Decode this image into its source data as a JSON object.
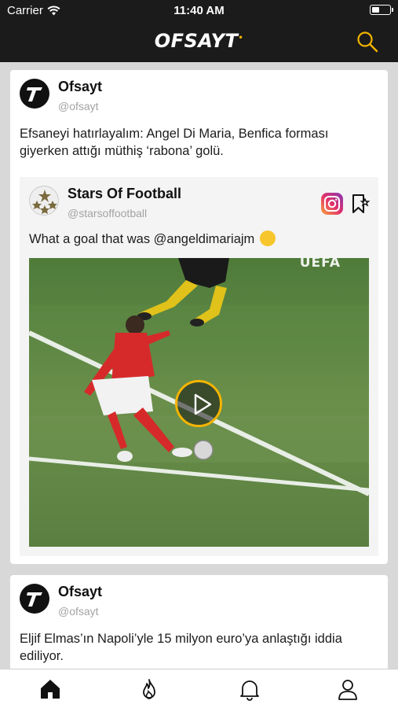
{
  "status_bar": {
    "carrier": "Carrier",
    "time": "11:40 AM"
  },
  "header": {
    "logo": "OFSAYT",
    "logo_mark": "•"
  },
  "posts": [
    {
      "author": "Ofsayt",
      "handle": "@ofsayt",
      "text": "Efsaneyi hatırlayalım: Angel Di Maria, Benfica forması giyerken attığı müthiş ‘rabona’ golü.",
      "embed": {
        "author": "Stars Of Football",
        "handle": "@starsoffootball",
        "caption": "What a goal that was @angeldimariajm",
        "video_watermark": "UEFA"
      }
    },
    {
      "author": "Ofsayt",
      "handle": "@ofsayt",
      "text": "Eljif Elmas’ın Napoli’yle 15 milyon euro’ya anlaştığı iddia ediliyor."
    }
  ],
  "tabs": [
    "home-icon",
    "trending-icon",
    "notifications-icon",
    "profile-icon"
  ],
  "colors": {
    "brand_yellow": "#f4b400",
    "header_bg": "#1b1b1b"
  }
}
